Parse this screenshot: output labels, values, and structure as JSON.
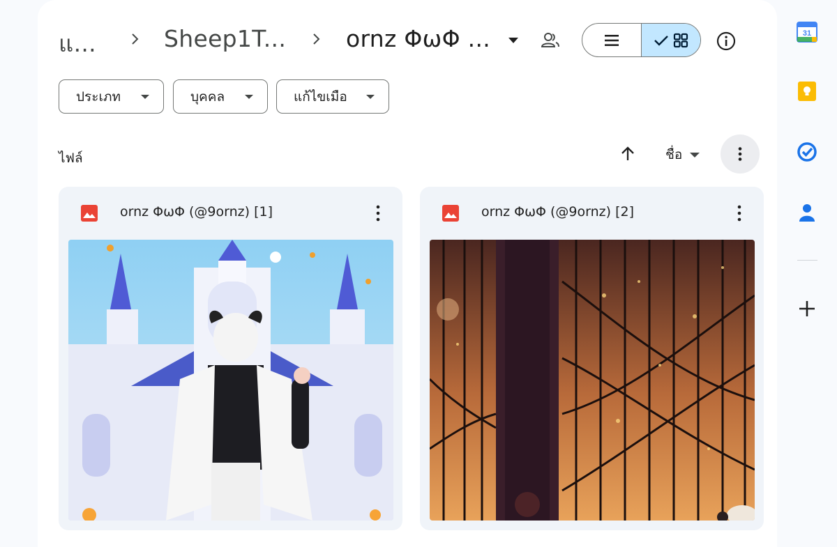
{
  "breadcrumb": {
    "items": [
      "แ...",
      "Sheep1T...",
      "ornz ΦωΦ ..."
    ]
  },
  "filters": {
    "type_label": "ประเภท",
    "people_label": "บุคคล",
    "modified_label": "แก้ไขเมือ"
  },
  "section": {
    "title": "ไฟล์",
    "sort_field": "ชื่อ"
  },
  "files": [
    {
      "name": "ornz ΦωΦ (@9ornz) [1]",
      "icon": "image-file-icon"
    },
    {
      "name": "ornz ΦωΦ (@9ornz) [2]",
      "icon": "image-file-icon"
    }
  ],
  "calendar": {
    "day": "31"
  },
  "colors": {
    "accent_selected": "#c2e7ff",
    "image_icon": "#ea4335",
    "calendar_blue": "#4285f4",
    "keep_yellow": "#fbbc04",
    "tasks_blue": "#1a73e8"
  },
  "icons": [
    "chevron-right-icon",
    "people-icon",
    "list-view-icon",
    "check-icon",
    "grid-view-icon",
    "info-icon",
    "arrow-up-icon",
    "more-vert-icon",
    "calendar-icon",
    "keep-icon",
    "tasks-icon",
    "contacts-icon",
    "plus-icon"
  ]
}
